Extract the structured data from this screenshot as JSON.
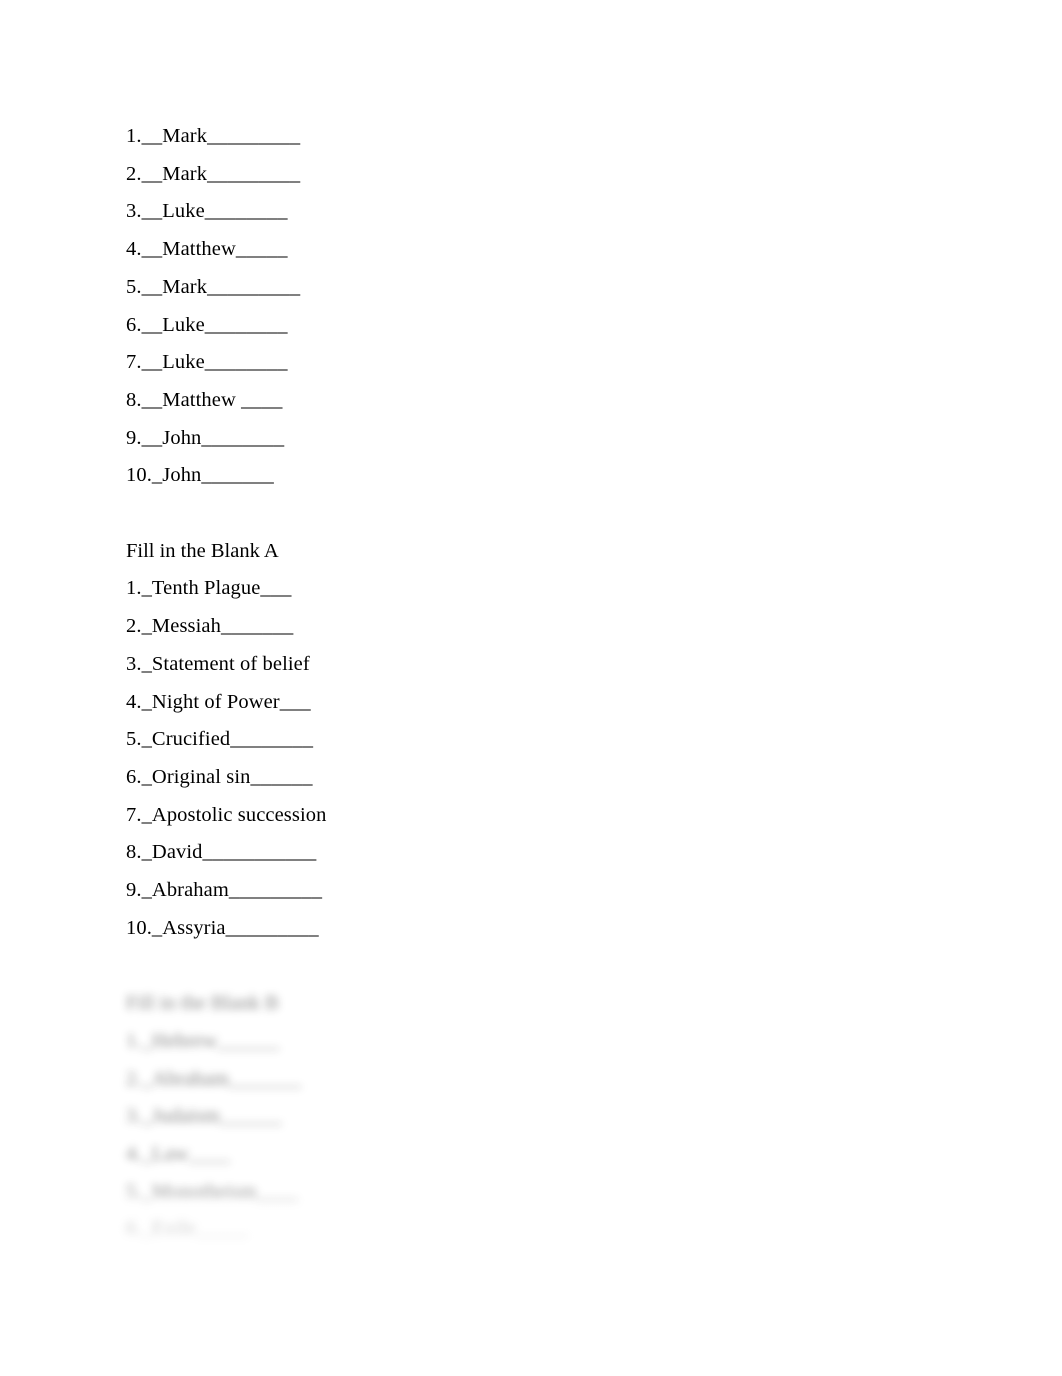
{
  "document": {
    "paper": "white",
    "text_color": "#000000"
  },
  "sections": [
    {
      "name": "gospel-answers",
      "heading": "",
      "items": [
        "1.__Mark_________",
        "2.__Mark_________",
        "3.__Luke________",
        "4.__Matthew_____",
        "5.__Mark_________",
        "6.__Luke________",
        "7.__Luke________",
        "8.__Matthew ____",
        "9.__John________",
        "10._John_______"
      ]
    },
    {
      "name": "fill-in-the-blank-a",
      "heading": "Fill in the Blank A",
      "items": [
        "1._Tenth Plague___",
        "2._Messiah_______",
        "3._Statement of belief",
        "4._Night of Power___",
        "5._Crucified________",
        "6._Original sin______",
        "7._Apostolic succession",
        "8._David___________",
        "9._Abraham_________",
        "10._Assyria_________"
      ]
    },
    {
      "name": "fill-in-the-blank-b-obscured",
      "heading": "Fill in the Blank B",
      "obscured": true,
      "items": [
        "1._Hebrew______",
        "2._Abraham_______",
        "3._Judaism______",
        "4._Law____",
        "5._Monotheism____",
        "6._Exile_____"
      ]
    }
  ]
}
